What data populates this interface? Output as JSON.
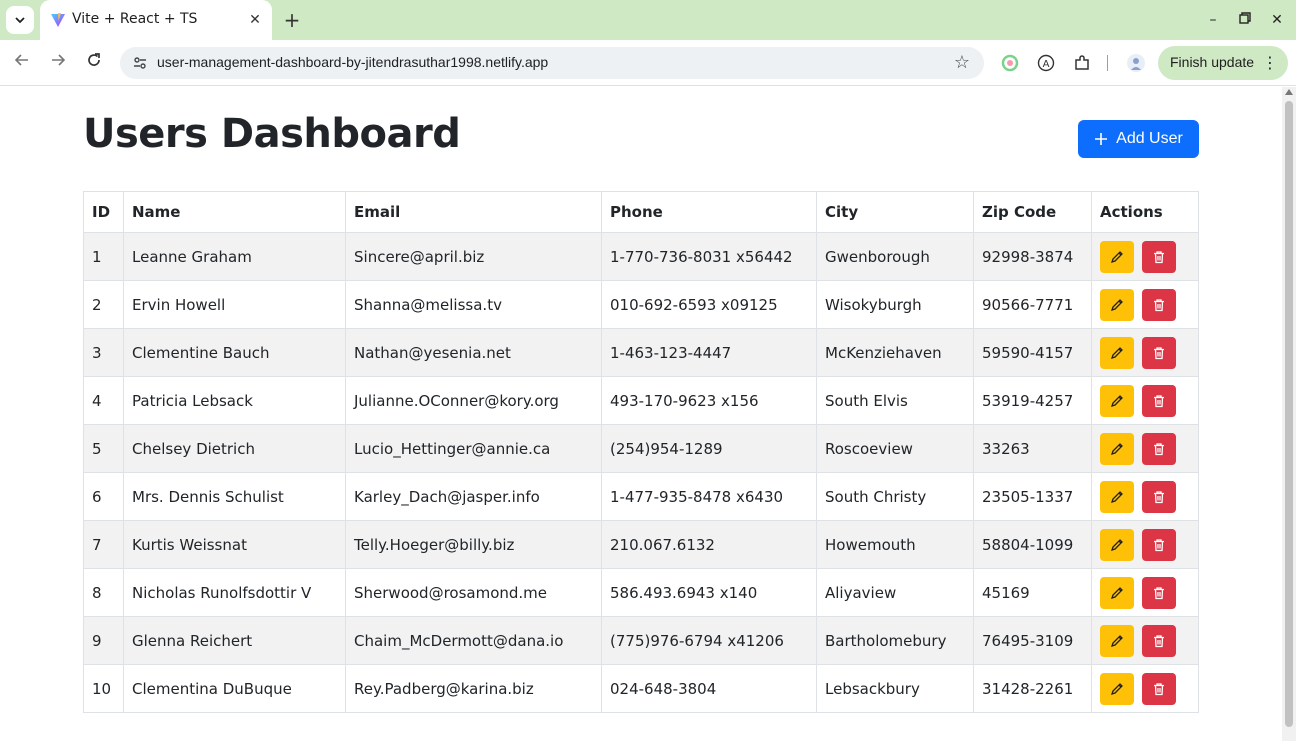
{
  "browser": {
    "tab_title": "Vite + React + TS",
    "url": "user-management-dashboard-by-jitendrasuthar1998.netlify.app",
    "finish_update_label": "Finish update"
  },
  "page": {
    "title": "Users Dashboard",
    "add_user_label": "Add User"
  },
  "table": {
    "headers": [
      "ID",
      "Name",
      "Email",
      "Phone",
      "City",
      "Zip Code",
      "Actions"
    ],
    "rows": [
      {
        "id": "1",
        "name": "Leanne Graham",
        "email": "Sincere@april.biz",
        "phone": "1-770-736-8031 x56442",
        "city": "Gwenborough",
        "zip": "92998-3874"
      },
      {
        "id": "2",
        "name": "Ervin Howell",
        "email": "Shanna@melissa.tv",
        "phone": "010-692-6593 x09125",
        "city": "Wisokyburgh",
        "zip": "90566-7771"
      },
      {
        "id": "3",
        "name": "Clementine Bauch",
        "email": "Nathan@yesenia.net",
        "phone": "1-463-123-4447",
        "city": "McKenziehaven",
        "zip": "59590-4157"
      },
      {
        "id": "4",
        "name": "Patricia Lebsack",
        "email": "Julianne.OConner@kory.org",
        "phone": "493-170-9623 x156",
        "city": "South Elvis",
        "zip": "53919-4257"
      },
      {
        "id": "5",
        "name": "Chelsey Dietrich",
        "email": "Lucio_Hettinger@annie.ca",
        "phone": "(254)954-1289",
        "city": "Roscoeview",
        "zip": "33263"
      },
      {
        "id": "6",
        "name": "Mrs. Dennis Schulist",
        "email": "Karley_Dach@jasper.info",
        "phone": "1-477-935-8478 x6430",
        "city": "South Christy",
        "zip": "23505-1337"
      },
      {
        "id": "7",
        "name": "Kurtis Weissnat",
        "email": "Telly.Hoeger@billy.biz",
        "phone": "210.067.6132",
        "city": "Howemouth",
        "zip": "58804-1099"
      },
      {
        "id": "8",
        "name": "Nicholas Runolfsdottir V",
        "email": "Sherwood@rosamond.me",
        "phone": "586.493.6943 x140",
        "city": "Aliyaview",
        "zip": "45169"
      },
      {
        "id": "9",
        "name": "Glenna Reichert",
        "email": "Chaim_McDermott@dana.io",
        "phone": "(775)976-6794 x41206",
        "city": "Bartholomebury",
        "zip": "76495-3109"
      },
      {
        "id": "10",
        "name": "Clementina DuBuque",
        "email": "Rey.Padberg@karina.biz",
        "phone": "024-648-3804",
        "city": "Lebsackbury",
        "zip": "31428-2261"
      }
    ]
  },
  "colors": {
    "primary": "#0d6efd",
    "edit": "#ffc107",
    "delete": "#dc3545",
    "tabbar": "#cfe9c4"
  },
  "icons": {
    "edit": "pencil-icon",
    "delete": "trash-icon",
    "add": "plus-icon"
  }
}
